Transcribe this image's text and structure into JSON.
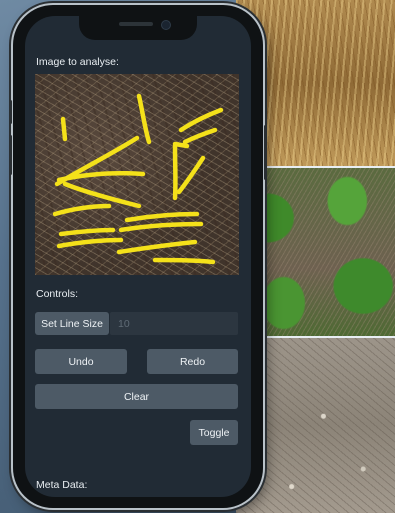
{
  "screen": {
    "image_label": "Image to analyse:",
    "controls_label": "Controls:",
    "set_line_size_label": "Set Line Size",
    "line_size_value": "10",
    "undo_label": "Undo",
    "redo_label": "Redo",
    "clear_label": "Clear",
    "toggle_label": "Toggle",
    "meta_label": "Meta Data:"
  },
  "colors": {
    "annotation_stroke": "#f4e11a",
    "button_bg": "#4d5a66",
    "screen_bg": "#212b35"
  }
}
